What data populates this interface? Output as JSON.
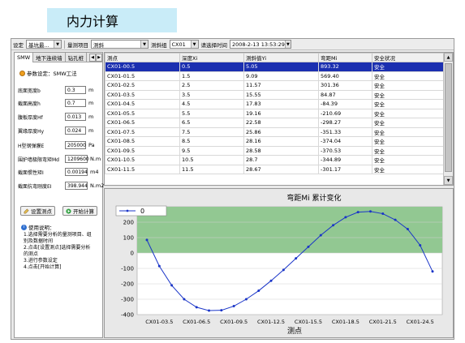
{
  "slide_title": "内力计算",
  "toolbar": {
    "setting_label": "设定",
    "setting_value": "基坑最...",
    "measure_item_label": "量测项目",
    "measure_item_value": "测斜",
    "group_label": "测斜组",
    "group_value": "CX01",
    "time_label": "请选择时间",
    "time_value": "2008-2-13 13:53:29"
  },
  "left_panel": {
    "tabs": [
      "SMW",
      "地下连续墙",
      "钻孔桩"
    ],
    "param_header": "参数设定：SMW工法",
    "params": [
      {
        "label": "底面宽度b",
        "value": "0.3",
        "unit": "m"
      },
      {
        "label": "截面高度h",
        "value": "0.7",
        "unit": "m"
      },
      {
        "label": "腹板厚度Hf",
        "value": "0.013",
        "unit": "m"
      },
      {
        "label": "翼缘厚度Hy",
        "value": "0.024",
        "unit": "m"
      },
      {
        "label": "H型钢弹膜E",
        "value": "205000",
        "unit": "Pa"
      },
      {
        "label": "围护墙极限弯矩Md",
        "value": "1209600",
        "unit": "N.m"
      },
      {
        "label": "截面惯性矩I",
        "value": "0.00194",
        "unit": "m4"
      },
      {
        "label": "截面抗弯刚度EI",
        "value": "398.944",
        "unit": "N.m2"
      }
    ],
    "btn_set_point": "设置测点",
    "btn_start_calc": "开始计算",
    "help_title": "使用说明：",
    "help_lines": [
      "1.选择需要分析的量测项目、组",
      "别及数据时间",
      "2.点击[设置测点]选择需要分析",
      "的测点",
      "3.进行参数设定",
      "4.点击[开始计算]"
    ]
  },
  "table": {
    "headers": [
      "测点",
      "深度Xi",
      "测斜值Yi",
      "弯距Mi",
      "安全状况"
    ],
    "rows": [
      [
        "CX01-00.5",
        "0.5",
        "5.05",
        "893.32",
        "安全"
      ],
      [
        "CX01-01.5",
        "1.5",
        "9.09",
        "569.40",
        "安全"
      ],
      [
        "CX01-02.5",
        "2.5",
        "11.57",
        "301.36",
        "安全"
      ],
      [
        "CX01-03.5",
        "3.5",
        "15.55",
        "84.87",
        "安全"
      ],
      [
        "CX01-04.5",
        "4.5",
        "17.83",
        "-84.39",
        "安全"
      ],
      [
        "CX01-05.5",
        "5.5",
        "19.16",
        "-210.69",
        "安全"
      ],
      [
        "CX01-06.5",
        "6.5",
        "22.58",
        "-298.27",
        "安全"
      ],
      [
        "CX01-07.5",
        "7.5",
        "25.86",
        "-351.33",
        "安全"
      ],
      [
        "CX01-08.5",
        "8.5",
        "28.16",
        "-374.04",
        "安全"
      ],
      [
        "CX01-09.5",
        "9.5",
        "28.58",
        "-370.53",
        "安全"
      ],
      [
        "CX01-10.5",
        "10.5",
        "28.7",
        "-344.89",
        "安全"
      ],
      [
        "CX01-11.5",
        "11.5",
        "28.67",
        "-301.17",
        "安全"
      ]
    ]
  },
  "chart_data": {
    "type": "line",
    "title": "弯距Mi 累计变化",
    "xlabel": "测点",
    "ylabel": "",
    "legend": [
      "0"
    ],
    "legend_position": "top-left",
    "ylim": [
      -400,
      300
    ],
    "yticks": [
      200,
      100,
      0,
      -100,
      -200,
      -300,
      -400
    ],
    "x_tick_labels": [
      "CX01-03.5",
      "CX01-06.5",
      "CX01-09.5",
      "CX01-12.5",
      "CX01-15.5",
      "CX01-18.5",
      "CX01-21.5",
      "CX01-24.5"
    ],
    "band": {
      "from": 0,
      "to": 300,
      "color": "#92c892"
    },
    "series": [
      {
        "name": "0",
        "color": "#1a35c8",
        "x": [
          "CX01-02.5",
          "CX01-03.5",
          "CX01-04.5",
          "CX01-05.5",
          "CX01-06.5",
          "CX01-07.5",
          "CX01-08.5",
          "CX01-09.5",
          "CX01-10.5",
          "CX01-11.5",
          "CX01-12.5",
          "CX01-13.5",
          "CX01-14.5",
          "CX01-15.5",
          "CX01-16.5",
          "CX01-17.5",
          "CX01-18.5",
          "CX01-19.5",
          "CX01-20.5",
          "CX01-21.5",
          "CX01-22.5",
          "CX01-23.5",
          "CX01-24.5",
          "CX01-25.5"
        ],
        "values": [
          85,
          -85,
          -210,
          -300,
          -352,
          -374,
          -372,
          -345,
          -300,
          -245,
          -180,
          -110,
          -35,
          40,
          115,
          180,
          232,
          265,
          270,
          255,
          215,
          155,
          50,
          -120
        ]
      }
    ]
  }
}
